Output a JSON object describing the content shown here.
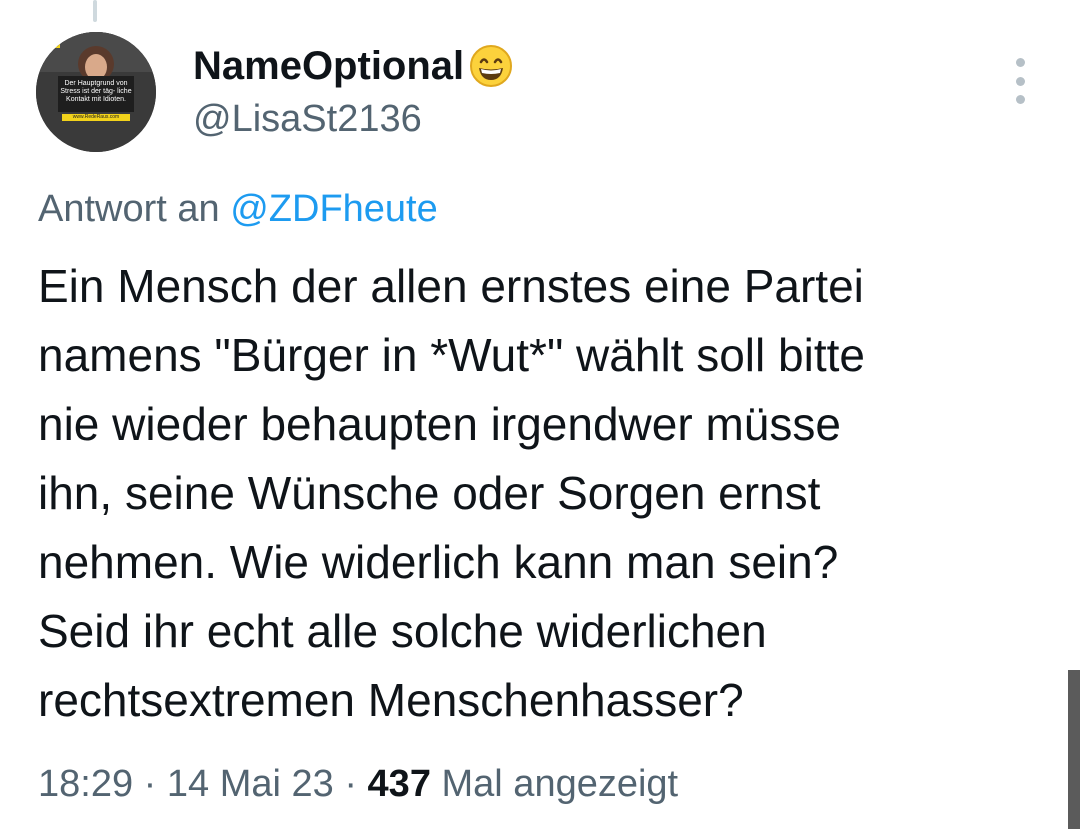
{
  "author": {
    "display_name": "NameOptional",
    "emoji_icon": "grinning-face-with-smiling-eyes",
    "handle": "@LisaSt2136",
    "avatar": {
      "caption": "Der Hauptgrund von Stress ist der täg- liche Kontakt mit Idioten.",
      "url_text": "www.RedeRaus.com"
    }
  },
  "reply": {
    "prefix": "Antwort an",
    "mention": "@ZDFheute"
  },
  "tweet": {
    "lines": [
      "Ein Mensch der allen ernstes eine Partei",
      "namens \"Bürger in *Wut*\" wählt soll bitte",
      "nie wieder behaupten irgendwer müsse",
      "ihn, seine Wünsche oder Sorgen ernst",
      "nehmen. Wie widerlich kann man sein?",
      "Seid ihr echt alle solche widerlichen",
      "rechtsextremen Menschenhasser?"
    ]
  },
  "meta": {
    "time": "18:29",
    "separator": "·",
    "date": "14 Mai 23",
    "views_count": "437",
    "views_label": "Mal angezeigt"
  },
  "colors": {
    "text": "#0f1419",
    "secondary": "#536471",
    "link": "#1d9bf0"
  }
}
